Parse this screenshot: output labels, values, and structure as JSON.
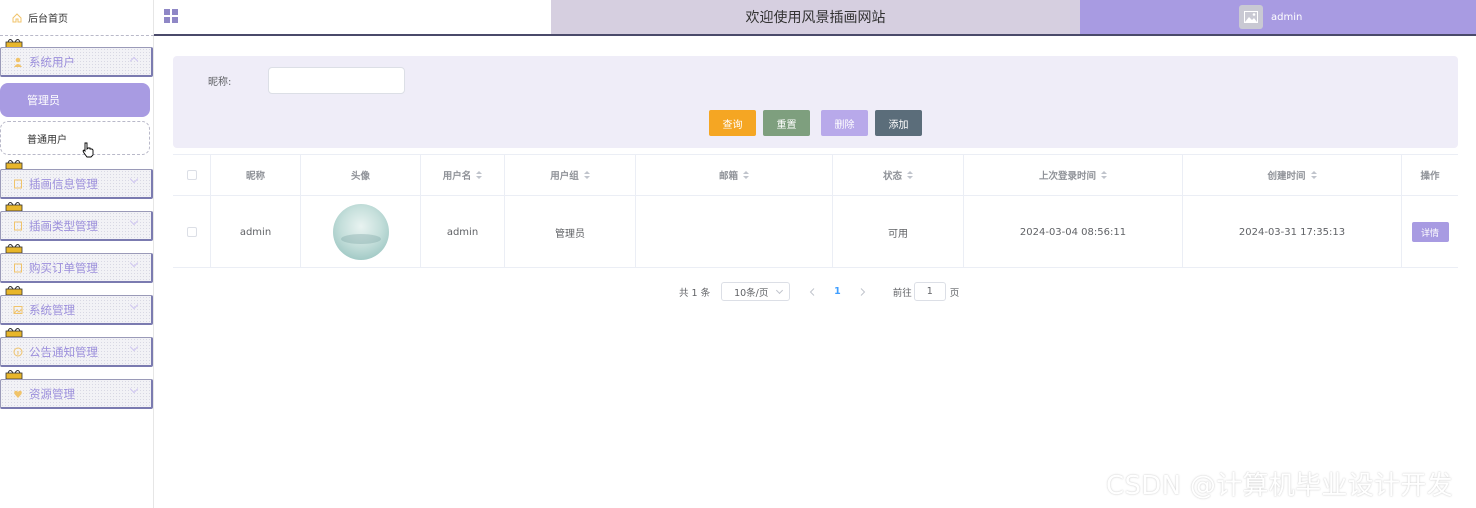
{
  "sidebar": {
    "home_label": "后台首页",
    "menu": [
      {
        "label": "系统用户",
        "icon": "user-icon"
      },
      {
        "label": "插画信息管理",
        "icon": "doc-icon"
      },
      {
        "label": "插画类型管理",
        "icon": "doc-icon"
      },
      {
        "label": "购买订单管理",
        "icon": "doc-icon"
      },
      {
        "label": "系统管理",
        "icon": "image-icon"
      },
      {
        "label": "公告通知管理",
        "icon": "info-icon"
      },
      {
        "label": "资源管理",
        "icon": "heart-icon"
      }
    ],
    "submenu": {
      "active": "管理员",
      "normal": "普通用户"
    }
  },
  "header": {
    "title": "欢迎使用风景插画网站",
    "username": "admin"
  },
  "search": {
    "label": "昵称:",
    "value": "",
    "buttons": {
      "query": "查询",
      "reset": "重置",
      "delete": "删除",
      "add": "添加"
    }
  },
  "table": {
    "headers": [
      "昵称",
      "头像",
      "用户名",
      "用户组",
      "邮箱",
      "状态",
      "上次登录时间",
      "创建时间",
      "操作"
    ],
    "rows": [
      {
        "nickname": "admin",
        "username": "admin",
        "group": "管理员",
        "email": "",
        "status": "可用",
        "last_login": "2024-03-04 08:56:11",
        "created": "2024-03-31 17:35:13",
        "action": "详情"
      }
    ]
  },
  "pagination": {
    "total": "共 1 条",
    "page_size": "10条/页",
    "current_page": "1",
    "goto_label": "前往",
    "goto_value": "1",
    "page_suffix": "页"
  },
  "watermark": "CSDN @计算机毕业设计开发",
  "colors": {
    "accent": "#a89be2",
    "title_bg": "#d6cfe0",
    "query": "#f5a623",
    "reset": "#7e9f7e",
    "delete": "#b8a9ea",
    "add": "#5b6d7a"
  }
}
